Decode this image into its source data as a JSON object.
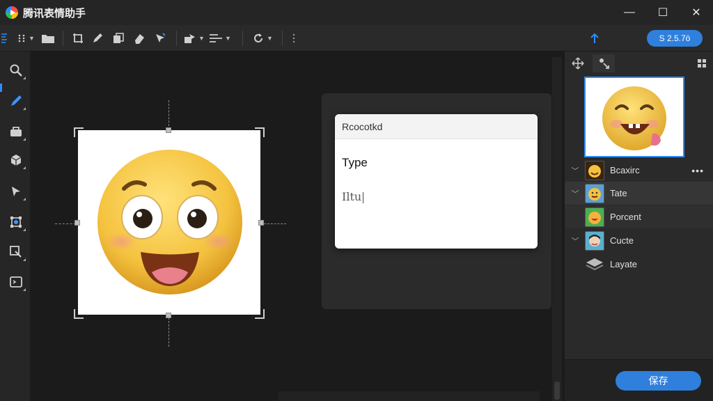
{
  "app": {
    "title": "腾讯表情助手"
  },
  "window": {
    "minimize": "—",
    "maximize": "☐",
    "close": "✕"
  },
  "toolbar": {
    "version_label": "S 2.5.7ö",
    "icons": [
      "align-icon",
      "grid-icon",
      "folder-icon",
      "crop-icon",
      "pen-icon",
      "copy-icon",
      "eraser-icon",
      "cursor-icon",
      "shape-icon",
      "distribute-icon",
      "rotate-icon",
      "more-icon",
      "upload-icon"
    ]
  },
  "left_tools": {
    "icons": [
      "zoom-icon",
      "brush-icon",
      "bucket-icon",
      "cube-icon",
      "select-icon",
      "transform-icon",
      "export-icon",
      "script-icon"
    ],
    "active": "brush-icon"
  },
  "dialog": {
    "header": "Rcocotkd",
    "type_label": "Type",
    "input_value": "Iltu"
  },
  "layers": [
    {
      "name": "Bcaxirc",
      "expanded": true,
      "selected": false,
      "more": "•••"
    },
    {
      "name": "Tate",
      "expanded": true,
      "selected": true
    },
    {
      "name": "Porcent",
      "expanded": false,
      "selected": false
    },
    {
      "name": "Cucte",
      "expanded": true,
      "selected": false
    },
    {
      "name": "Layate",
      "expanded": false,
      "selected": false
    }
  ],
  "actions": {
    "save_label": "保存"
  },
  "colors": {
    "accent": "#2f7fdc",
    "background": "#1e1e1e",
    "panel": "#2a2a2a"
  }
}
